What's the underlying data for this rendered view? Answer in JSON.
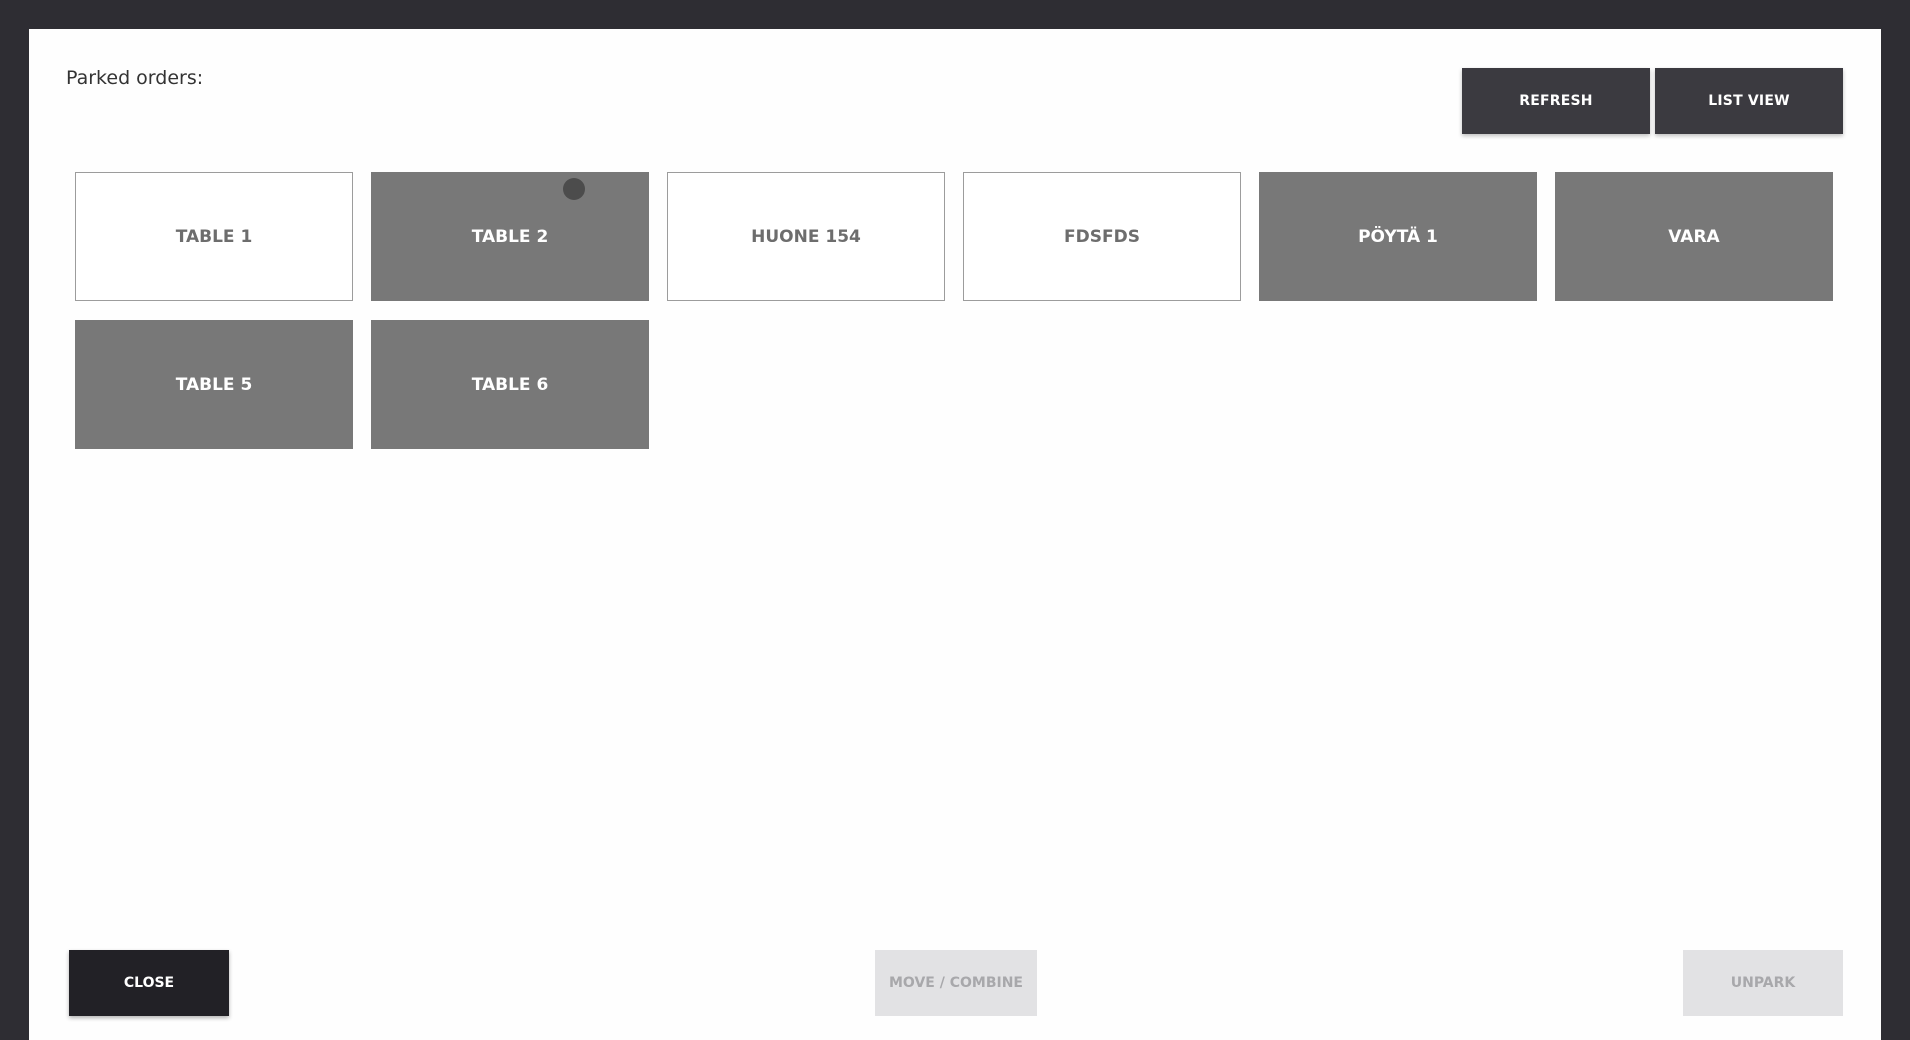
{
  "dialog": {
    "title": "Parked orders:"
  },
  "toolbar": {
    "refresh_label": "REFRESH",
    "list_view_label": "LIST VIEW"
  },
  "tables": [
    {
      "label": "TABLE 1",
      "status": "free"
    },
    {
      "label": "TABLE 2",
      "status": "occupied",
      "indicator": true
    },
    {
      "label": "HUONE 154",
      "status": "free"
    },
    {
      "label": "FDSFDS",
      "status": "free"
    },
    {
      "label": "PÖYTÄ 1",
      "status": "occupied"
    },
    {
      "label": "VARA",
      "status": "occupied"
    },
    {
      "label": "TABLE 5",
      "status": "occupied"
    },
    {
      "label": "TABLE 6",
      "status": "occupied"
    }
  ],
  "footer": {
    "close_label": "CLOSE",
    "move_combine_label": "MOVE / COMBINE",
    "unpark_label": "UNPARK"
  },
  "colors": {
    "frame": "#2e2d33",
    "tile_occupied": "#787878",
    "tile_free_border": "#9c9c9c",
    "button_dark": "#3b3a40",
    "button_disabled": "#e2e2e4"
  }
}
